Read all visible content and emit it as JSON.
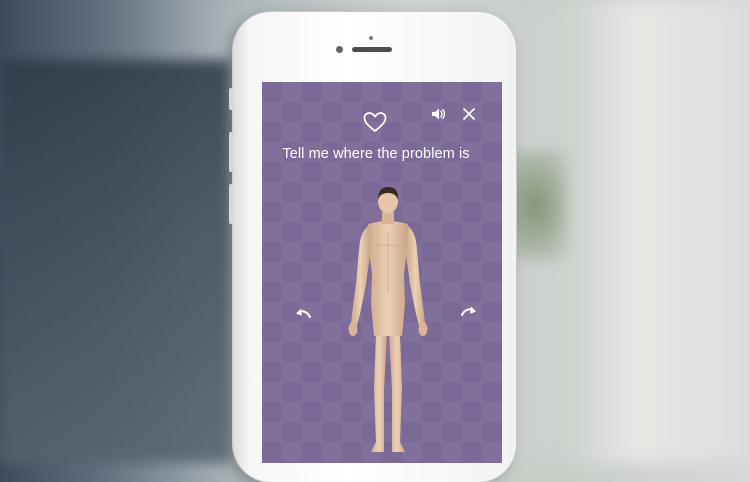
{
  "app": {
    "prompt_text": "Tell me where the problem is",
    "icons": {
      "favorite": "heart-icon",
      "sound": "speaker-icon",
      "close": "close-icon",
      "rotate_left": "rotate-left-arrow-icon",
      "rotate_right": "rotate-right-arrow-icon"
    },
    "colors": {
      "screen_background": "#7b6a97",
      "icon_white": "#ffffff",
      "skin": "#e6c6a7",
      "hair": "#3a2a1f"
    }
  }
}
